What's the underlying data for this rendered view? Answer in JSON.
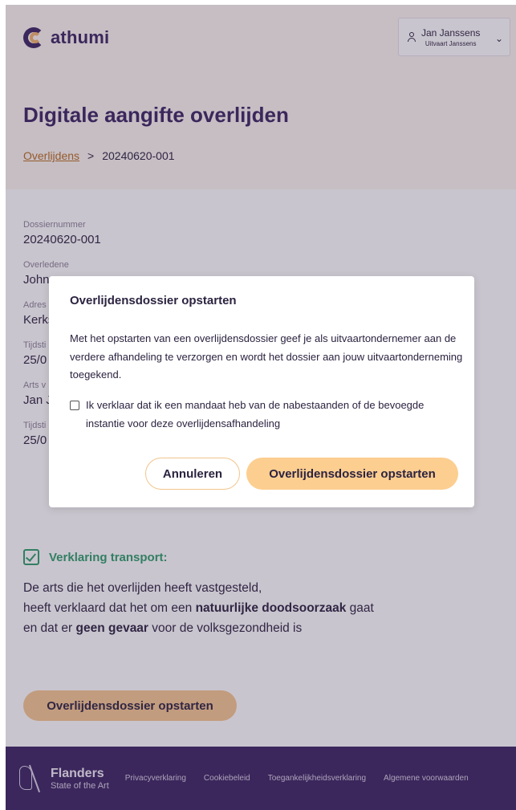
{
  "app": {
    "logo_text": "athumi",
    "user_name": "Jan Janssens",
    "user_company": "Uitvaart Janssens",
    "user_chevron": "⌄"
  },
  "page": {
    "title": "Digitale aangifte overlijden",
    "breadcrumb_link": "Overlijdens",
    "breadcrumb_sep": ">",
    "breadcrumb_current": "20240620-001"
  },
  "details": [
    {
      "label": "Dossiernummer",
      "value": "20240620-001"
    },
    {
      "label": "Overledene",
      "value": "John"
    },
    {
      "label": "Adres",
      "value": "Kerks"
    },
    {
      "label": "Tijdsti",
      "value": "25/0"
    },
    {
      "label": "Arts v",
      "value": "Jan Ja"
    },
    {
      "label": "Tijdsti",
      "value": "25/0"
    }
  ],
  "verklaring": {
    "title": "Verklaring transport:",
    "line1": "De arts die het overlijden heeft vastgesteld,",
    "line2_a": "heeft verklaard dat het om een ",
    "line2_b": "natuurlijke doodsoorzaak",
    "line2_c": " gaat",
    "line3_a": "en dat er ",
    "line3_b": "geen gevaar",
    "line3_c": " voor de volksgezondheid is"
  },
  "start_button_label": "Overlijdensdossier opstarten",
  "modal": {
    "title": "Overlijdensdossier opstarten",
    "body": "Met het opstarten van een overlijdensdossier geef je als uitvaartondernemer aan de verdere afhandeling te verzorgen en wordt het dossier aan jouw uitvaartonderneming toegekend.",
    "checkbox_label": "Ik verklaar dat ik een mandaat heb van de nabestaanden of de bevoegde instantie voor deze overlijdensafhandeling",
    "checkbox_checked": false,
    "cancel_label": "Annuleren",
    "confirm_label": "Overlijdensdossier opstarten"
  },
  "footer": {
    "brand_name": "Flanders",
    "brand_sub": "State of the Art",
    "links": [
      "Privacyverklaring",
      "Cookiebeleid",
      "Toegankelijkheidsverklaring",
      "Algemene voorwaarden"
    ]
  },
  "colors": {
    "primary": "#3b2461",
    "accent": "#fcce90",
    "success": "#2f9e6a",
    "link": "#b86b1f"
  }
}
